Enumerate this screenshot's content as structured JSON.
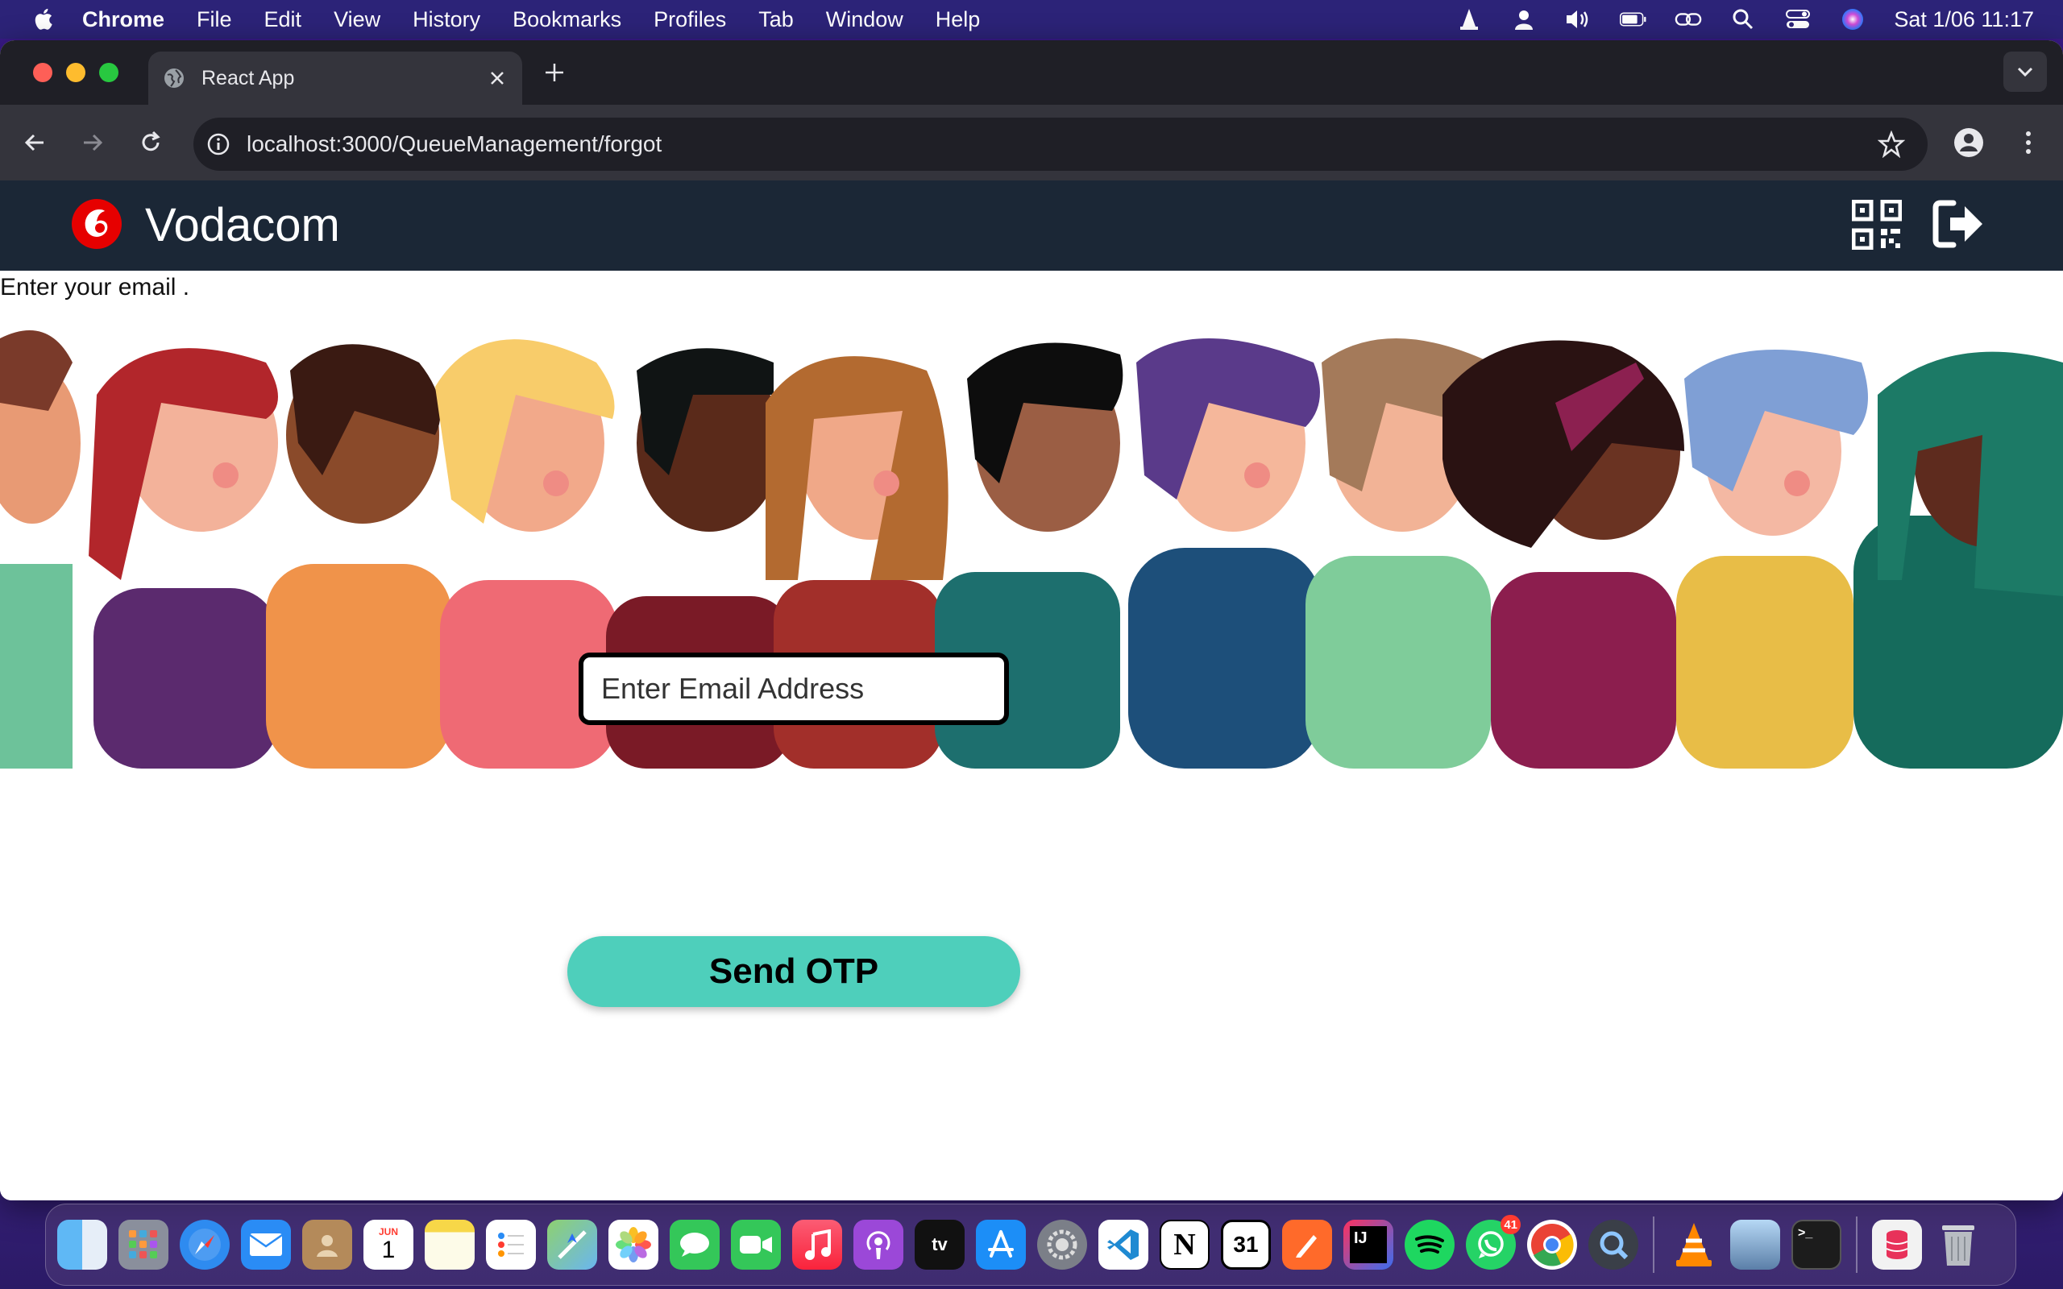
{
  "menubar": {
    "app_name": "Chrome",
    "items": [
      "File",
      "Edit",
      "View",
      "History",
      "Bookmarks",
      "Profiles",
      "Tab",
      "Window",
      "Help"
    ],
    "clock": "Sat 1/06  11:17"
  },
  "browser": {
    "tab_title": "React App",
    "url": "localhost:3000/QueueManagement/forgot"
  },
  "app": {
    "brand": "Vodacom",
    "brand_color": "#e60000",
    "header_bg": "#1b2736",
    "instruction": "Enter your email .",
    "email_placeholder": "Enter Email Address",
    "send_button": "Send OTP",
    "button_color": "#4ecfbb"
  },
  "dock": {
    "calendar_month": "JUN",
    "calendar_day": "1",
    "whatsapp_badge": "41",
    "apps": [
      "finder",
      "launchpad",
      "safari",
      "mail",
      "contacts",
      "calendar",
      "notes",
      "reminders",
      "maps",
      "photos",
      "messages",
      "facetime",
      "music",
      "podcasts",
      "tv",
      "app-store",
      "system-settings",
      "vscode",
      "notion",
      "google-calendar",
      "draw",
      "intellij",
      "spotify",
      "whatsapp",
      "chrome",
      "quicktime",
      "vlc",
      "preview",
      "terminal",
      "database",
      "trash"
    ]
  }
}
